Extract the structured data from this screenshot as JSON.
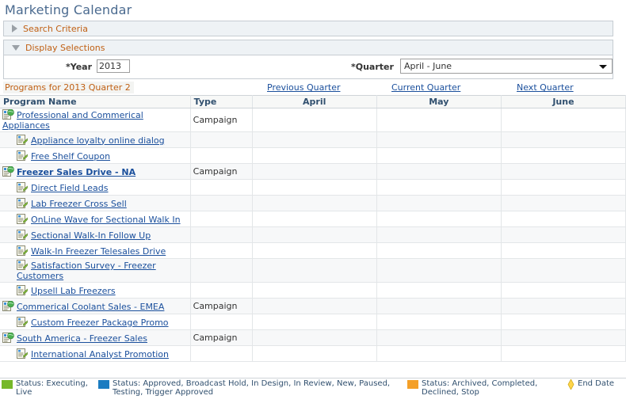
{
  "page": {
    "title": "Marketing Calendar"
  },
  "sections": {
    "search": {
      "label": "Search Criteria",
      "icon": "triangle-right-icon",
      "expanded": false
    },
    "display": {
      "label": "Display Selections",
      "icon": "triangle-down-icon",
      "expanded": true
    }
  },
  "form": {
    "year": {
      "label": "*Year",
      "value": "2013"
    },
    "quarter": {
      "label": "*Quarter",
      "value": "April - June",
      "icon": "chevron-down-icon"
    }
  },
  "results": {
    "title": "Programs for 2013 Quarter 2",
    "nav": {
      "previous": "Previous Quarter",
      "current": "Current Quarter",
      "next": "Next Quarter"
    },
    "columns": {
      "name": "Program Name",
      "type": "Type",
      "month1": "April",
      "month2": "May",
      "month3": "June"
    },
    "rows": [
      {
        "name": "Professional and Commerical Appliances",
        "type": "Campaign",
        "level": "program",
        "icon": "program-globe-icon",
        "bold": false
      },
      {
        "name": "Appliance loyalty online dialog",
        "type": "",
        "level": "child",
        "icon": "campaign-document-icon",
        "bold": false
      },
      {
        "name": "Free Shelf Coupon",
        "type": "",
        "level": "child",
        "icon": "campaign-document-icon",
        "bold": false
      },
      {
        "name": "Freezer Sales Drive - NA",
        "type": "Campaign",
        "level": "program",
        "icon": "program-globe-icon",
        "bold": true
      },
      {
        "name": "Direct Field Leads",
        "type": "",
        "level": "child",
        "icon": "campaign-document-icon",
        "bold": false
      },
      {
        "name": "Lab Freezer Cross Sell",
        "type": "",
        "level": "child",
        "icon": "campaign-document-icon",
        "bold": false
      },
      {
        "name": "OnLine Wave for Sectional Walk In",
        "type": "",
        "level": "child",
        "icon": "campaign-document-icon",
        "bold": false
      },
      {
        "name": "Sectional Walk-In Follow Up",
        "type": "",
        "level": "child",
        "icon": "campaign-document-icon",
        "bold": false
      },
      {
        "name": "Walk-In Freezer Telesales Drive",
        "type": "",
        "level": "child",
        "icon": "campaign-document-icon",
        "bold": false
      },
      {
        "name": "Satisfaction Survey - Freezer Customers",
        "type": "",
        "level": "child",
        "icon": "campaign-document-icon",
        "bold": false
      },
      {
        "name": "Upsell Lab Freezers",
        "type": "",
        "level": "child",
        "icon": "campaign-document-icon",
        "bold": false
      },
      {
        "name": "Commerical Coolant Sales - EMEA",
        "type": "Campaign",
        "level": "program",
        "icon": "program-globe-icon",
        "bold": false
      },
      {
        "name": "Custom Freezer Package Promo",
        "type": "",
        "level": "child",
        "icon": "campaign-document-icon",
        "bold": false
      },
      {
        "name": "South America - Freezer Sales",
        "type": "Campaign",
        "level": "program",
        "icon": "program-globe-icon",
        "bold": false
      },
      {
        "name": "International Analyst Promotion",
        "type": "",
        "level": "child",
        "icon": "campaign-document-icon",
        "bold": false
      }
    ]
  },
  "legend": {
    "items": [
      {
        "color": "#76b82a",
        "text": "Status: Executing, Live",
        "icon": "legend-swatch-green"
      },
      {
        "color": "#1b7cc1",
        "text": "Status: Approved, Broadcast Hold, In Design, In Review, New, Paused, Testing, Trigger Approved",
        "icon": "legend-swatch-blue"
      },
      {
        "color": "#f4a028",
        "text": "Status: Archived, Completed, Declined, Stop",
        "icon": "legend-swatch-orange"
      },
      {
        "color": "#ffd54a",
        "text": "End Date",
        "icon": "end-date-diamond-icon"
      }
    ]
  },
  "colors": {
    "link": "#1a4f9c",
    "section_label": "#c06014",
    "header_text": "#31506f",
    "title": "#4a6a8f"
  }
}
